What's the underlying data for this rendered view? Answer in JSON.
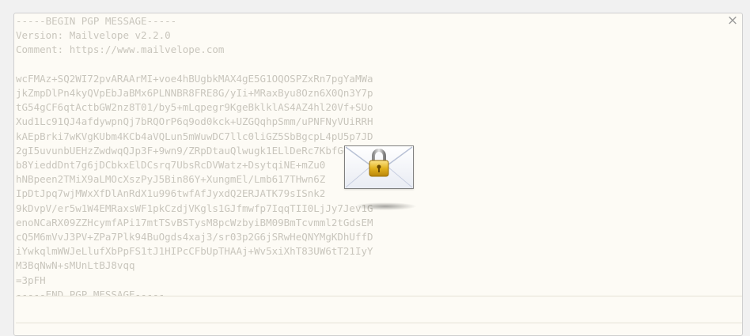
{
  "decrypt_frame": {
    "close_symbol": "×",
    "armored_text": "-----BEGIN PGP MESSAGE-----\nVersion: Mailvelope v2.2.0\nComment: https://www.mailvelope.com\n\nwcFMAz+SQ2WI72pvARAArMI+voe4hBUgbkMAX4gE5G1OQOSPZxRn7pgYaMWa\njkZmpDlPn4kyQVpEbJaBMx6PLNNBR8FRE8G/yIi+MRaxByu8Ozn6X0Qn3Y7p\ntG54gCF6qtActbGW2nz8T01/by5+mLqpegr9KgeBklklAS4AZ4hl20Vf+SUo\nXud1Lc91QJ4afdywpnQj7bRQOrP6q9od0kck+UZGQqhpSmm/uPNFNyVUiRRH\nkAEpBrki7wKVgKUbm4KCb4aVQLun5mWuwDC7llc0liGZ5SbBgcpL4pU5p7JD\n2gI5uvunbUEHzZwdwqQJp3F+9wn9/ZRpDtauQlwugk1ELlDeRc7KbfGgU9ki\nb8YieddDnt7g6jDCbkxElDCsrq7UbsRcDVWatz+DsytqiNE+mZu0\nhNBpeen2TMiX9aLMOcXszPyJ5Bin86Y+XungmEl/Lmb617THwn6Z\nIpDtJpq7wjMWxXfDlAnRdX1u996twfAfJyxdQ2ERJATK79sISnk2\n9kDvpV/er5w1W4EMRaxsWF1pkCzdjVKgls1GJfmwfp7IqqTII0LjJy7Jev1G\nenoNCaRX09ZZHcymfAPi17mtTSvBSTysM8pcWzbyiBM09BmTcvmml2tGdsEM\ncQ5M6mVvJ3PV+ZPa7Plk94BuOgds4xaj3/sr03p2G6jSRwHeQNYMgKDhUffD\niYwkqlmWWJeLlufXbPpFS1tJ1HIPcCFbUpTHAAj+Wv5xiXhT83UW6tT21IyY\nM3BqNwN+sMUnLtBJ8vqq\n=3pFH\n-----END PGP MESSAGE-----"
  }
}
